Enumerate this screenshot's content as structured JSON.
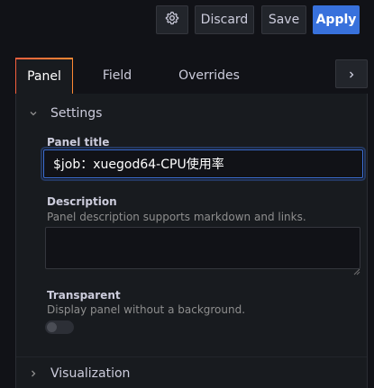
{
  "toolbar": {
    "gear_icon": "gear-icon",
    "discard_label": "Discard",
    "save_label": "Save",
    "apply_label": "Apply"
  },
  "tabs": [
    {
      "label": "Panel",
      "active": true
    },
    {
      "label": "Field",
      "active": false
    },
    {
      "label": "Overrides",
      "active": false
    }
  ],
  "tab_expand_icon": "chevron-right-icon",
  "settings": {
    "header": "Settings",
    "panel_title": {
      "label": "Panel title",
      "value": "$job：xuegod64-CPU使用率"
    },
    "description": {
      "label": "Description",
      "help": "Panel description supports markdown and links.",
      "value": ""
    },
    "transparent": {
      "label": "Transparent",
      "help": "Display panel without a background.",
      "enabled": false
    }
  },
  "visualization": {
    "header": "Visualization"
  },
  "colors": {
    "accent": "#3871dc",
    "tab_highlight_start": "#f55f3e",
    "tab_highlight_end": "#ff8833",
    "background": "#111217",
    "pane": "#181b1f"
  }
}
